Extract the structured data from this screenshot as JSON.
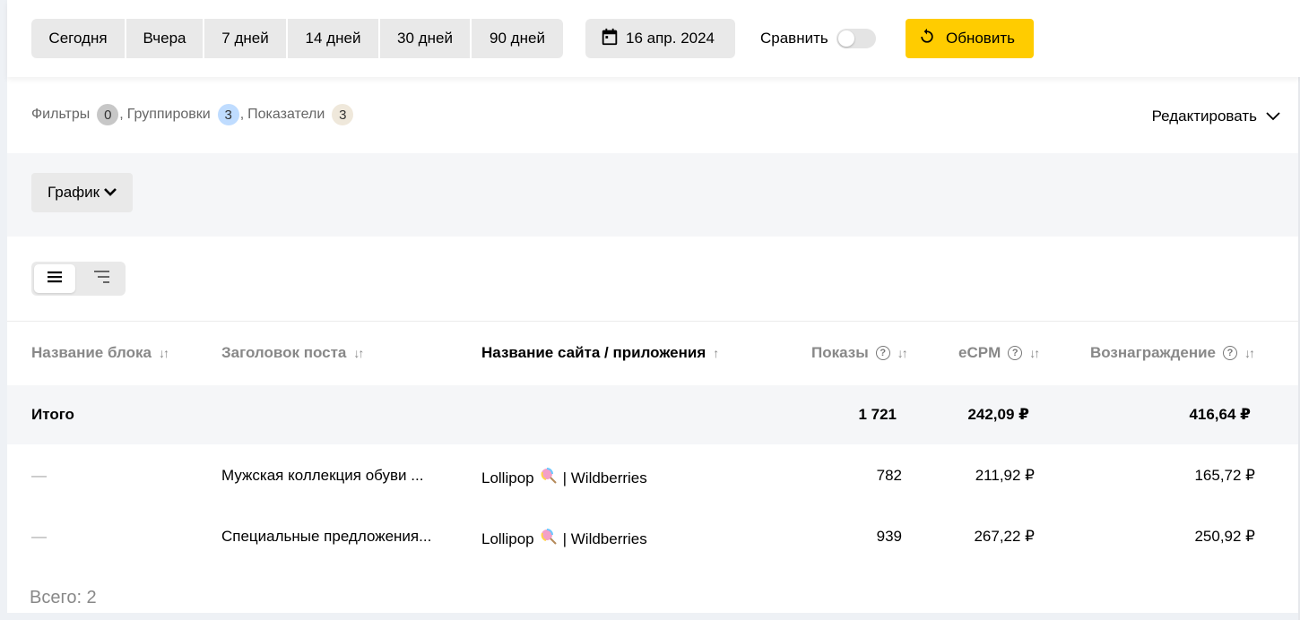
{
  "toolbar": {
    "periods": [
      "Сегодня",
      "Вчера",
      "7 дней",
      "14 дней",
      "30 дней",
      "90 дней"
    ],
    "date": "16 апр. 2024",
    "compare_label": "Сравнить",
    "compare_enabled": false,
    "refresh_label": "Обновить",
    "accent_color": "#ffcc00"
  },
  "filters": {
    "filters_label": "Фильтры",
    "filters_count": "0",
    "groupings_label": "Группировки",
    "groupings_count": "3",
    "metrics_label": "Показатели",
    "metrics_count": "3",
    "edit_label": "Редактировать"
  },
  "chart": {
    "button_label": "График"
  },
  "view": {
    "active": "list"
  },
  "table": {
    "columns": [
      {
        "label": "Название блока",
        "sort": "↓↑",
        "help": false,
        "active": false
      },
      {
        "label": "Заголовок поста",
        "sort": "↓↑",
        "help": false,
        "active": false
      },
      {
        "label": "Название сайта / приложения",
        "sort": "↑",
        "help": false,
        "active": true
      },
      {
        "label": "Показы",
        "sort": "↓↑",
        "help": true,
        "active": false
      },
      {
        "label": "eCPM",
        "sort": "↓↑",
        "help": true,
        "active": false
      },
      {
        "label": "Вознаграждение",
        "sort": "↓↑",
        "help": true,
        "active": false
      }
    ],
    "total": {
      "label": "Итого",
      "shows": "1 721",
      "ecpm": "242,09 ₽",
      "reward": "416,64 ₽"
    },
    "rows": [
      {
        "block": "—",
        "post": "Мужская коллекция обуви ...",
        "site_prefix": "Lollipop",
        "site_suffix": "| Wildberries",
        "shows": "782",
        "ecpm": "211,92 ₽",
        "reward": "165,72 ₽"
      },
      {
        "block": "—",
        "post": "Специальные предложения...",
        "site_prefix": "Lollipop",
        "site_suffix": "| Wildberries",
        "shows": "939",
        "ecpm": "267,22 ₽",
        "reward": "250,92 ₽"
      }
    ],
    "total_count": "Всего: 2"
  }
}
